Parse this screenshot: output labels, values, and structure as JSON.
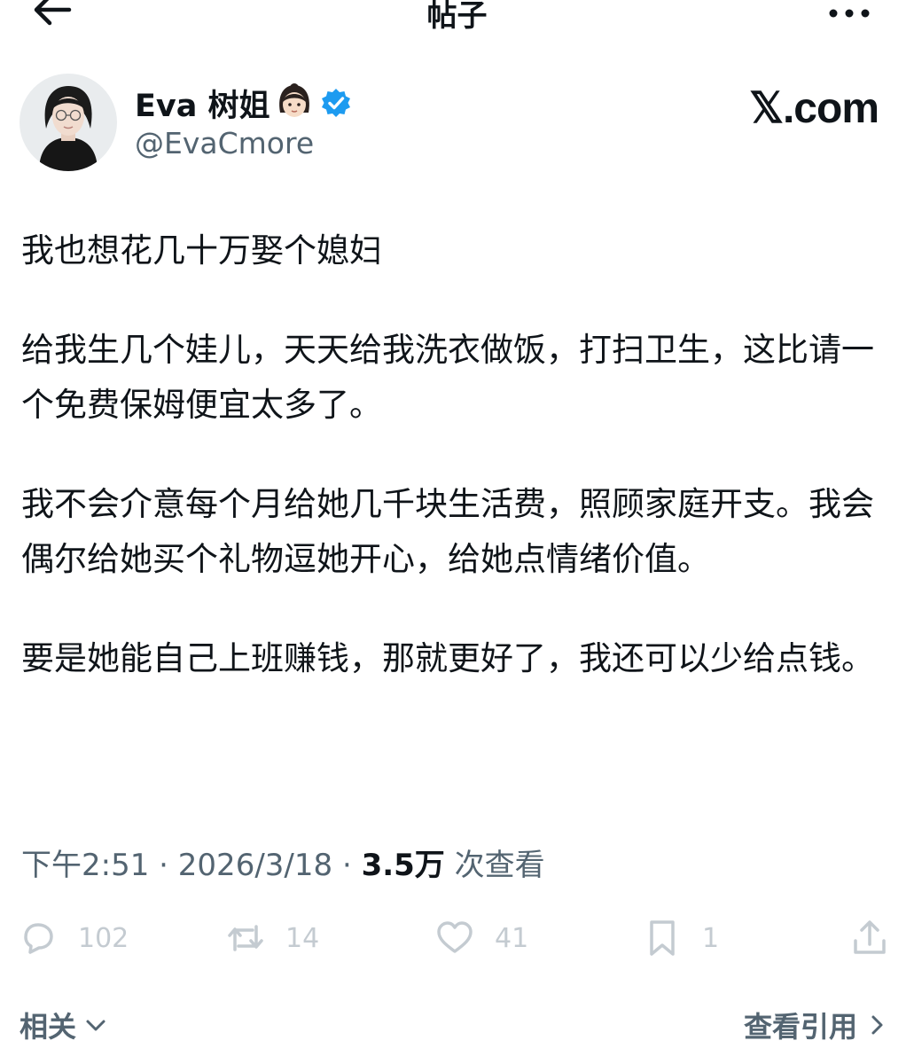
{
  "header": {
    "title": "帖子"
  },
  "author": {
    "display_name": "Eva 树姐",
    "handle": "@EvaCmore"
  },
  "brand": "𝕏.com",
  "post": {
    "paragraphs": [
      "我也想花几十万娶个媳妇",
      "给我生几个娃儿，天天给我洗衣做饭，打扫卫生，这比请一个免费保姆便宜太多了。",
      "我不会介意每个月给她几千块生活费，照顾家庭开支。我会偶尔给她买个礼物逗她开心，给她点情绪价值。",
      "要是她能自己上班赚钱，那就更好了，我还可以少给点钱。"
    ]
  },
  "meta": {
    "time": "下午2:51",
    "separator": "·",
    "date": "2026/3/18",
    "views_count": "3.5万",
    "views_label": "次查看"
  },
  "actions": {
    "reply": {
      "icon": "reply-icon",
      "count": "102"
    },
    "retweet": {
      "icon": "retweet-icon",
      "count": "14"
    },
    "like": {
      "icon": "heart-icon",
      "count": "41"
    },
    "bookmark": {
      "icon": "bookmark-icon",
      "count": "1"
    },
    "share": {
      "icon": "share-icon"
    }
  },
  "footer": {
    "related_label": "相关",
    "quotes_label": "查看引用"
  },
  "colors": {
    "text": "#0f1419",
    "secondary": "#536471",
    "icon_light": "#c4cbd1",
    "verified": "#1d9bf0"
  }
}
